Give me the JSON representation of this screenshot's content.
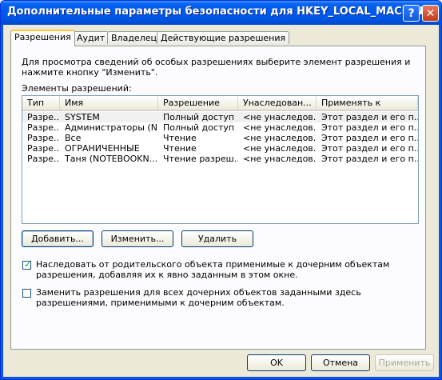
{
  "window": {
    "title": "Дополнительные параметры безопасности для HKEY_LOCAL_MACHINE",
    "help_glyph": "?",
    "close_glyph": "✕"
  },
  "tabs": [
    {
      "label": "Разрешения",
      "active": true
    },
    {
      "label": "Аудит"
    },
    {
      "label": "Владелец"
    },
    {
      "label": "Действующие разрешения"
    }
  ],
  "panel": {
    "description": "Для просмотра сведений об особых разрешениях выберите элемент разрешения и нажмите кнопку \"Изменить\".",
    "entries_label": "Элементы разрешений:",
    "columns": [
      "Тип",
      "Имя",
      "Разрешение",
      "Унаследован...",
      "Применять к"
    ],
    "rows": [
      [
        "Разре...",
        "SYSTEM",
        "Полный доступ",
        "<не унаследов...",
        "Этот раздел и его п..."
      ],
      [
        "Разре...",
        "Администраторы (N...",
        "Полный доступ",
        "<не унаследов...",
        "Этот раздел и его п..."
      ],
      [
        "Разре...",
        "Все",
        "Чтение",
        "<не унаследов...",
        "Этот раздел и его п..."
      ],
      [
        "Разре...",
        "ОГРАНИЧЕННЫЕ",
        "Чтение",
        "<не унаследов...",
        "Этот раздел и его п..."
      ],
      [
        "Разре...",
        "Таня (NOTEBOOKN...",
        "Чтение разреш...",
        "<не унаследов...",
        "Этот раздел и его п..."
      ]
    ],
    "buttons": {
      "add": "Добавить...",
      "edit": "Изменить...",
      "remove": "Удалить"
    },
    "inherit_checkbox": {
      "label": "Наследовать от родительского объекта применимые к дочерним объектам разрешения, добавляя их к явно заданным в этом окне.",
      "checked": true
    },
    "replace_checkbox": {
      "label": "Заменить разрешения для всех дочерних объектов заданными здесь разрешениями, применимыми к дочерним объектам.",
      "checked": false
    }
  },
  "footer": {
    "ok": "OK",
    "cancel": "Отмена",
    "apply": "Применить"
  },
  "colors": {
    "titlebar": "#0058ee",
    "face": "#ece9d8",
    "check": "#21a121"
  }
}
